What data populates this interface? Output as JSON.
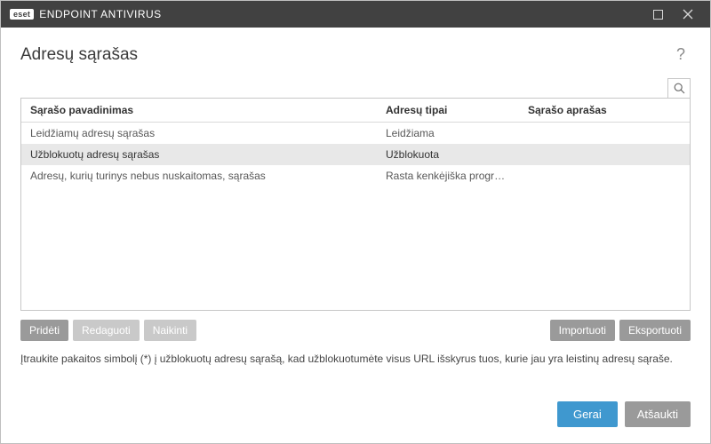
{
  "titlebar": {
    "brand_badge": "eset",
    "brand_text": "ENDPOINT ANTIVIRUS"
  },
  "header": {
    "title": "Adresų sąrašas"
  },
  "table": {
    "columns": {
      "name": "Sąrašo pavadinimas",
      "type": "Adresų tipai",
      "desc": "Sąrašo aprašas"
    },
    "rows": [
      {
        "name": "Leidžiamų adresų sąrašas",
        "type": "Leidžiama",
        "desc": "",
        "selected": false
      },
      {
        "name": "Užblokuotų adresų sąrašas",
        "type": "Užblokuota",
        "desc": "",
        "selected": true
      },
      {
        "name": "Adresų, kurių turinys nebus nuskaitomas, sąrašas",
        "type": "Rasta kenkėjiška programi...",
        "desc": "",
        "selected": false
      }
    ]
  },
  "toolbar": {
    "add": "Pridėti",
    "edit": "Redaguoti",
    "delete": "Naikinti",
    "import": "Importuoti",
    "export": "Eksportuoti"
  },
  "hint": "Įtraukite pakaitos simbolį (*) į užblokuotų adresų sąrašą, kad užblokuotumėte visus URL išskyrus tuos, kurie jau yra leistinų adresų sąraše.",
  "footer": {
    "ok": "Gerai",
    "cancel": "Atšaukti"
  }
}
